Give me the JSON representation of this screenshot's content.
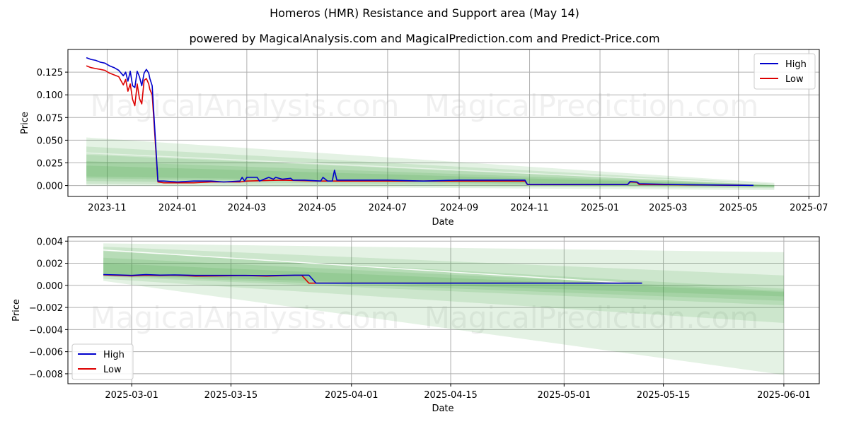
{
  "title": "Homeros (HMR) Resistance and Support area (May 14)",
  "subtitle": "powered by MagicalAnalysis.com and MagicalPrediction.com and Predict-Price.com",
  "watermark": [
    "MagicalAnalysis.com",
    "MagicalPrediction.com"
  ],
  "colors": {
    "high": "#0000cc",
    "low": "#dd0000",
    "band": "#2e9b2e",
    "grid": "#b0b0b0"
  },
  "chart_data": [
    {
      "type": "line",
      "xlabel": "Date",
      "ylabel": "Price",
      "xlim": [
        "2023-09-28",
        "2025-07-10"
      ],
      "ylim": [
        -0.012,
        0.15
      ],
      "xticks": [
        "2023-11",
        "2024-01",
        "2024-03",
        "2024-05",
        "2024-07",
        "2024-09",
        "2024-11",
        "2025-01",
        "2025-03",
        "2025-05",
        "2025-07"
      ],
      "yticks": [
        "0.000",
        "0.025",
        "0.050",
        "0.075",
        "0.100",
        "0.125"
      ],
      "grid": true,
      "legend": "top-right",
      "series": [
        {
          "name": "High",
          "x": [
            "2023-10-14",
            "2023-10-18",
            "2023-10-22",
            "2023-10-26",
            "2023-10-30",
            "2023-11-03",
            "2023-11-07",
            "2023-11-11",
            "2023-11-15",
            "2023-11-17",
            "2023-11-19",
            "2023-11-21",
            "2023-11-23",
            "2023-11-25",
            "2023-11-27",
            "2023-11-29",
            "2023-12-01",
            "2023-12-03",
            "2023-12-05",
            "2023-12-07",
            "2023-12-08",
            "2023-12-10",
            "2023-12-15",
            "2023-12-20",
            "2024-01-01",
            "2024-01-15",
            "2024-01-30",
            "2024-02-10",
            "2024-02-24",
            "2024-02-26",
            "2024-02-28",
            "2024-03-01",
            "2024-03-10",
            "2024-03-12",
            "2024-03-20",
            "2024-03-24",
            "2024-03-26",
            "2024-04-01",
            "2024-04-08",
            "2024-04-10",
            "2024-04-20",
            "2024-05-04",
            "2024-05-06",
            "2024-05-10",
            "2024-05-14",
            "2024-05-16",
            "2024-05-18",
            "2024-05-25",
            "2024-07-01",
            "2024-08-01",
            "2024-09-01",
            "2024-10-01",
            "2024-10-28",
            "2024-10-30",
            "2024-11-30",
            "2025-01-25",
            "2025-01-27",
            "2025-02-02",
            "2025-02-04",
            "2025-03-05",
            "2025-03-20",
            "2025-05-14"
          ],
          "values": [
            0.141,
            0.139,
            0.138,
            0.136,
            0.135,
            0.132,
            0.13,
            0.127,
            0.121,
            0.125,
            0.115,
            0.126,
            0.11,
            0.108,
            0.126,
            0.12,
            0.11,
            0.124,
            0.128,
            0.124,
            0.118,
            0.11,
            0.005,
            0.005,
            0.004,
            0.005,
            0.005,
            0.004,
            0.005,
            0.009,
            0.005,
            0.009,
            0.009,
            0.005,
            0.009,
            0.007,
            0.009,
            0.007,
            0.008,
            0.006,
            0.006,
            0.005,
            0.009,
            0.005,
            0.005,
            0.017,
            0.006,
            0.006,
            0.006,
            0.005,
            0.006,
            0.006,
            0.006,
            0.0014,
            0.0013,
            0.0012,
            0.0045,
            0.004,
            0.002,
            0.0012,
            0.0009,
            0.0002
          ]
        },
        {
          "name": "Low",
          "x": [
            "2023-10-14",
            "2023-10-18",
            "2023-10-22",
            "2023-10-26",
            "2023-10-30",
            "2023-11-03",
            "2023-11-07",
            "2023-11-11",
            "2023-11-15",
            "2023-11-17",
            "2023-11-19",
            "2023-11-21",
            "2023-11-23",
            "2023-11-25",
            "2023-11-27",
            "2023-11-29",
            "2023-12-01",
            "2023-12-03",
            "2023-12-05",
            "2023-12-07",
            "2023-12-08",
            "2023-12-10",
            "2023-12-15",
            "2023-12-20",
            "2024-01-01",
            "2024-01-15",
            "2024-01-30",
            "2024-02-10",
            "2024-02-24",
            "2024-03-01",
            "2024-04-01",
            "2024-05-01",
            "2024-06-01",
            "2024-07-01",
            "2024-08-01",
            "2024-09-01",
            "2024-10-01",
            "2024-10-28",
            "2024-10-30",
            "2024-11-30",
            "2025-01-25",
            "2025-01-27",
            "2025-02-02",
            "2025-02-04",
            "2025-03-05",
            "2025-03-20",
            "2025-05-14"
          ],
          "values": [
            0.132,
            0.13,
            0.129,
            0.128,
            0.127,
            0.124,
            0.122,
            0.12,
            0.111,
            0.117,
            0.104,
            0.112,
            0.095,
            0.088,
            0.112,
            0.096,
            0.09,
            0.116,
            0.118,
            0.112,
            0.106,
            0.1,
            0.004,
            0.003,
            0.003,
            0.003,
            0.004,
            0.004,
            0.004,
            0.005,
            0.006,
            0.005,
            0.005,
            0.005,
            0.005,
            0.005,
            0.005,
            0.005,
            0.0012,
            0.0011,
            0.0011,
            0.004,
            0.0035,
            0.0012,
            0.001,
            0.0008,
            0.0002
          ]
        }
      ],
      "bands": [
        {
          "x": [
            "2023-10-14",
            "2025-06-01"
          ],
          "upper": [
            0.053,
            0.003
          ],
          "lower": [
            0.0,
            -0.005
          ],
          "opacity": 0.13
        },
        {
          "x": [
            "2023-10-14",
            "2025-06-01"
          ],
          "upper": [
            0.043,
            0.002
          ],
          "lower": [
            0.002,
            -0.003
          ],
          "opacity": 0.13
        },
        {
          "x": [
            "2023-10-14",
            "2025-06-01"
          ],
          "upper": [
            0.034,
            0.001
          ],
          "lower": [
            0.005,
            -0.002
          ],
          "opacity": 0.13
        },
        {
          "x": [
            "2023-10-14",
            "2025-06-01"
          ],
          "upper": [
            0.027,
            0.0005
          ],
          "lower": [
            0.008,
            -0.0015
          ],
          "opacity": 0.13
        },
        {
          "x": [
            "2023-10-14",
            "2025-06-01"
          ],
          "upper": [
            0.022,
            0.0
          ],
          "lower": [
            0.01,
            -0.001
          ],
          "opacity": 0.13
        }
      ],
      "lines": [
        {
          "x": [
            "2023-10-14",
            "2025-06-01"
          ],
          "values": [
            0.036,
            0.001
          ],
          "color": "#ffffff",
          "opacity": 0.5
        }
      ]
    },
    {
      "type": "line",
      "xlabel": "Date",
      "ylabel": "Price",
      "xlim": [
        "2025-02-20",
        "2025-06-06"
      ],
      "ylim": [
        -0.0089,
        0.0044
      ],
      "xticks": [
        "2025-03-01",
        "2025-03-15",
        "2025-04-01",
        "2025-04-15",
        "2025-05-01",
        "2025-05-15",
        "2025-06-01"
      ],
      "yticks": [
        "-0.008",
        "-0.006",
        "-0.004",
        "-0.002",
        "0.000",
        "0.002",
        "0.004"
      ],
      "grid": true,
      "legend": "bottom-left",
      "series": [
        {
          "name": "High",
          "x": [
            "2025-02-25",
            "2025-02-27",
            "2025-03-01",
            "2025-03-03",
            "2025-03-05",
            "2025-03-07",
            "2025-03-10",
            "2025-03-13",
            "2025-03-17",
            "2025-03-20",
            "2025-03-24",
            "2025-03-26",
            "2025-03-27",
            "2025-04-10",
            "2025-05-01",
            "2025-05-12"
          ],
          "values": [
            0.00098,
            0.00095,
            0.0009,
            0.00097,
            0.00093,
            0.00095,
            0.0009,
            0.0009,
            0.0009,
            0.00088,
            0.00092,
            0.00092,
            0.0002,
            0.0002,
            0.0002,
            0.0002
          ]
        },
        {
          "name": "Low",
          "x": [
            "2025-02-25",
            "2025-02-27",
            "2025-03-01",
            "2025-03-03",
            "2025-03-05",
            "2025-03-07",
            "2025-03-10",
            "2025-03-13",
            "2025-03-17",
            "2025-03-20",
            "2025-03-24",
            "2025-03-25",
            "2025-03-26",
            "2025-04-10",
            "2025-05-01",
            "2025-05-12"
          ],
          "values": [
            0.00095,
            0.0009,
            0.00085,
            0.00092,
            0.00088,
            0.00092,
            0.00084,
            0.00086,
            0.00088,
            0.00084,
            0.0009,
            0.0009,
            0.0002,
            0.0002,
            0.0002,
            0.0002
          ]
        }
      ],
      "bands": [
        {
          "x": [
            "2025-02-25",
            "2025-06-01"
          ],
          "upper": [
            0.0038,
            0.003
          ],
          "lower": [
            0.0004,
            -0.0081
          ],
          "opacity": 0.13
        },
        {
          "x": [
            "2025-02-25",
            "2025-06-01"
          ],
          "upper": [
            0.0035,
            0.0009
          ],
          "lower": [
            0.0006,
            -0.0034
          ],
          "opacity": 0.13
        },
        {
          "x": [
            "2025-02-25",
            "2025-06-01"
          ],
          "upper": [
            0.0031,
            -0.0003
          ],
          "lower": [
            0.0008,
            -0.0018
          ],
          "opacity": 0.13
        },
        {
          "x": [
            "2025-02-25",
            "2025-06-01"
          ],
          "upper": [
            0.0025,
            -0.0005
          ],
          "lower": [
            0.0009,
            -0.0014
          ],
          "opacity": 0.13
        },
        {
          "x": [
            "2025-02-25",
            "2025-06-01"
          ],
          "upper": [
            0.002,
            -0.0006
          ],
          "lower": [
            0.001,
            -0.001
          ],
          "opacity": 0.13
        }
      ],
      "lines": [
        {
          "x": [
            "2025-02-25",
            "2025-05-10"
          ],
          "values": [
            0.0032,
            0.0002
          ],
          "color": "#ffffff",
          "opacity": 0.9
        }
      ]
    }
  ]
}
